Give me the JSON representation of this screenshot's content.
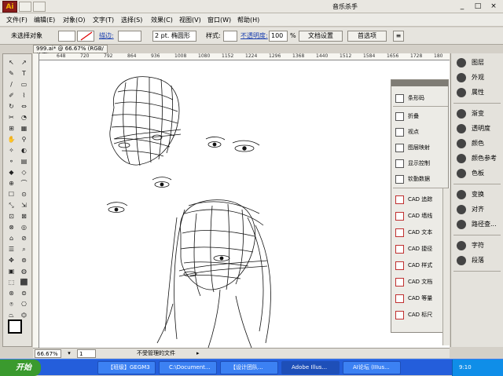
{
  "app": {
    "logo": "Ai",
    "workspace": "音乐杀手"
  },
  "menu": [
    "文件(F)",
    "编辑(E)",
    "对象(O)",
    "文字(T)",
    "选择(S)",
    "效果(C)",
    "视图(V)",
    "窗口(W)",
    "帮助(H)"
  ],
  "control": {
    "selection": "未选择对象",
    "stroke_label": "描边:",
    "brush": "2 pt. 椭圆形",
    "style_label": "样式:",
    "opacity_label": "不透明度:",
    "opacity_value": "100",
    "opacity_unit": "%",
    "doc_settings": "文档设置",
    "preferences": "首选项"
  },
  "document": {
    "tab": "999.ai* @ 66.67% (RGB/轮廓)",
    "ruler": [
      "648",
      "720",
      "792",
      "864",
      "936",
      "1008",
      "1080",
      "1152",
      "1224",
      "1296",
      "1368",
      "1440",
      "1512",
      "1584",
      "1656",
      "1728",
      "180"
    ]
  },
  "floating_panel": {
    "items": [
      {
        "label": "条形码",
        "icon": "barcode-icon",
        "cad": false
      },
      {
        "label": "折叠",
        "icon": "fold-icon",
        "cad": false
      },
      {
        "label": "视点",
        "icon": "viewpoint-icon",
        "cad": false
      },
      {
        "label": "图层映射",
        "icon": "layer-map-icon",
        "cad": false
      },
      {
        "label": "显示控制",
        "icon": "display-icon",
        "cad": false
      },
      {
        "label": "钦勤数据",
        "icon": "data-icon",
        "cad": false
      },
      {
        "label": "CAD 追踪",
        "icon": "cad-trace-icon",
        "cad": true
      },
      {
        "label": "CAD 墙线",
        "icon": "cad-wall-icon",
        "cad": true
      },
      {
        "label": "CAD 文本",
        "icon": "cad-text-icon",
        "cad": true
      },
      {
        "label": "CAD 捷径",
        "icon": "cad-shortcut-icon",
        "cad": true
      },
      {
        "label": "CAD 样式",
        "icon": "cad-style-icon",
        "cad": true
      },
      {
        "label": "CAD 文档",
        "icon": "cad-doc-icon",
        "cad": true
      },
      {
        "label": "CAD 等量",
        "icon": "cad-equal-icon",
        "cad": true
      },
      {
        "label": "CAD 标尺",
        "icon": "cad-ruler-icon",
        "cad": true
      }
    ]
  },
  "right_panel": {
    "groups": [
      [
        {
          "label": "图层",
          "icon": "layers-icon"
        },
        {
          "label": "外观",
          "icon": "appearance-icon"
        },
        {
          "label": "属性",
          "icon": "attributes-icon"
        }
      ],
      [
        {
          "label": "渐变",
          "icon": "gradient-icon"
        },
        {
          "label": "透明度",
          "icon": "transparency-icon"
        },
        {
          "label": "颜色",
          "icon": "color-icon"
        },
        {
          "label": "颜色参考",
          "icon": "color-guide-icon"
        },
        {
          "label": "色板",
          "icon": "swatches-icon"
        }
      ],
      [
        {
          "label": "变换",
          "icon": "transform-icon"
        },
        {
          "label": "对齐",
          "icon": "align-icon"
        },
        {
          "label": "路径查...",
          "icon": "pathfinder-icon"
        }
      ],
      [
        {
          "label": "字符",
          "icon": "character-icon"
        },
        {
          "label": "段落",
          "icon": "paragraph-icon"
        }
      ]
    ]
  },
  "status": {
    "zoom": "66.67%",
    "page": "1",
    "message": "不受管理的文件"
  },
  "taskbar": {
    "start": "开始",
    "tasks": [
      "【班级】GEGM3",
      "C:\\Document...",
      "【设计团队...",
      "Adobe Illus...",
      "AI论坛 (IIIus..."
    ],
    "clock": "9:10"
  }
}
